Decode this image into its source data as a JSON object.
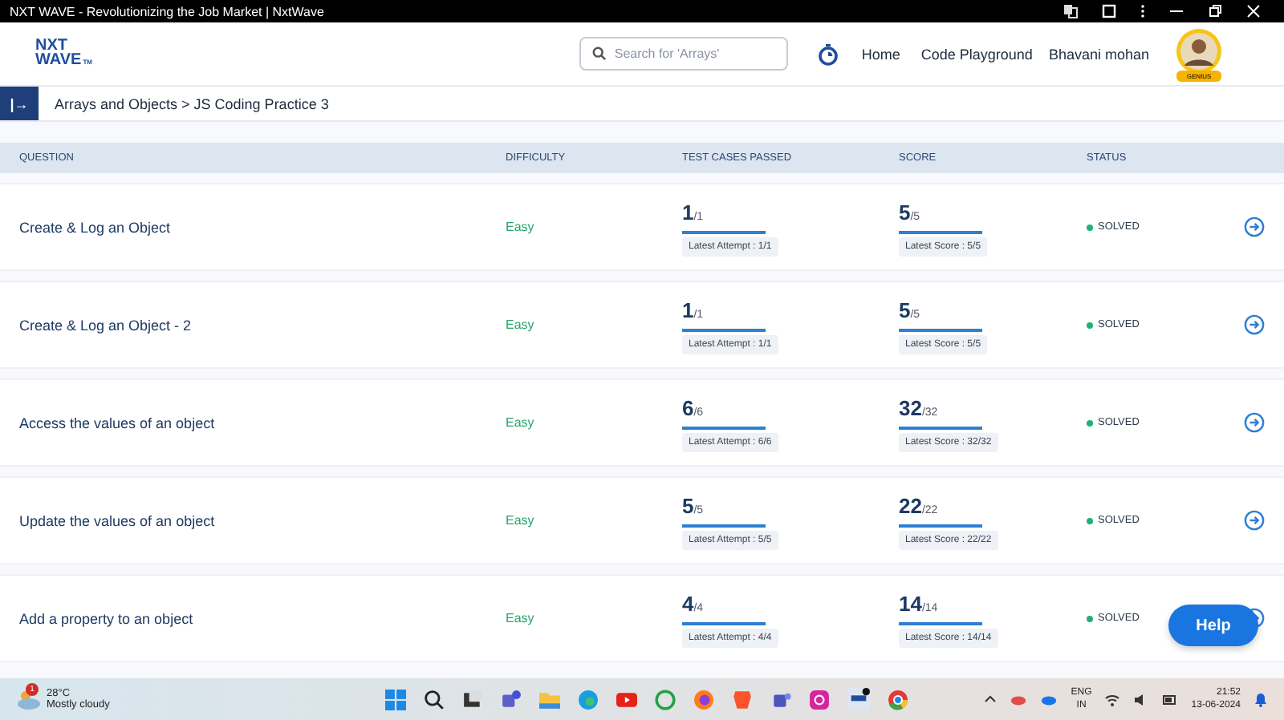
{
  "window": {
    "title": "NXT WAVE - Revolutionizing the Job Market | NxtWave"
  },
  "header": {
    "logo_top": "NXT",
    "logo_bottom": "WAVE",
    "logo_suffix": "TM",
    "search": {
      "placeholder": "Search for 'Arrays'"
    },
    "nav": [
      "Home",
      "Code Playground"
    ],
    "user": "Bhavani mohan",
    "badge": "GENIUS"
  },
  "breadcrumb": {
    "toggle": "|→",
    "path": "Arrays and Objects > JS Coding Practice 3"
  },
  "table": {
    "columns": [
      "QUESTION",
      "DIFFICULTY",
      "TEST CASES PASSED",
      "SCORE",
      "STATUS"
    ],
    "rows": [
      {
        "question": "Create & Log an Object",
        "difficulty": "Easy",
        "passed": "1",
        "passed_total": "/1",
        "passed_bar": {
          "level": 1
        },
        "attempt": "Latest Attempt : 1/1",
        "score": "5",
        "score_total": "/5",
        "score_bar": {
          "level": 1
        },
        "score_note": "Latest Score : 5/5",
        "status": "SOLVED"
      },
      {
        "question": "Create & Log an Object - 2",
        "difficulty": "Easy",
        "passed": "1",
        "passed_total": "/1",
        "passed_bar": {
          "level": 1
        },
        "attempt": "Latest Attempt : 1/1",
        "score": "5",
        "score_total": "/5",
        "score_bar": {
          "level": 1
        },
        "score_note": "Latest Score : 5/5",
        "status": "SOLVED"
      },
      {
        "question": "Access the values of an object",
        "difficulty": "Easy",
        "passed": "6",
        "passed_total": "/6",
        "passed_bar": {
          "level": 1
        },
        "attempt": "Latest Attempt : 6/6",
        "score": "32",
        "score_total": "/32",
        "score_bar": {
          "level": 1
        },
        "score_note": "Latest Score : 32/32",
        "status": "SOLVED"
      },
      {
        "question": "Update the values of an object",
        "difficulty": "Easy",
        "passed": "5",
        "passed_total": "/5",
        "passed_bar": {
          "level": 1
        },
        "attempt": "Latest Attempt : 5/5",
        "score": "22",
        "score_total": "/22",
        "score_bar": {
          "level": 1
        },
        "score_note": "Latest Score : 22/22",
        "status": "SOLVED"
      },
      {
        "question": "Add a property to an object",
        "difficulty": "Easy",
        "passed": "4",
        "passed_total": "/4",
        "passed_bar": {
          "level": 1
        },
        "attempt": "Latest Attempt : 4/4",
        "score": "14",
        "score_total": "/14",
        "score_bar": {
          "level": 1
        },
        "score_note": "Latest Score : 14/14",
        "status": "SOLVED"
      }
    ]
  },
  "help": "Help",
  "taskbar": {
    "weather_badge": "1",
    "temperature": "28°C",
    "weather": "Mostly cloudy",
    "lang_top": "ENG",
    "lang_bottom": "IN",
    "time": "21:52",
    "date": "13-06-2024"
  }
}
